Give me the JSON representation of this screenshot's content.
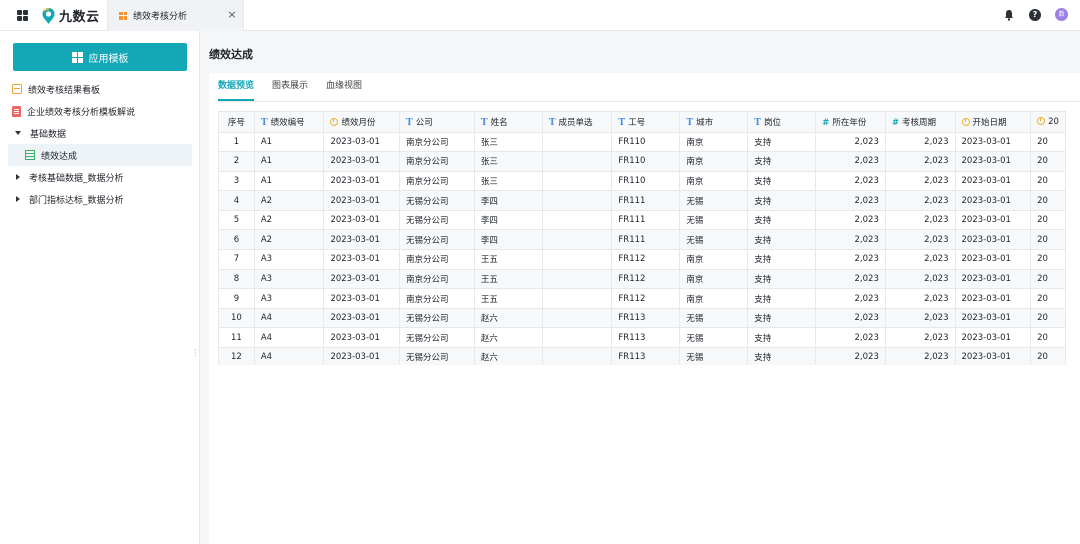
{
  "topbar": {
    "logo_text": "九数云",
    "tab_title": "绩效考核分析",
    "tab_close": "×",
    "help_glyph": "?",
    "avatar_text": "数"
  },
  "sidebar": {
    "apply_button": "应用模板",
    "items": [
      {
        "label": "绩效考核结果看板",
        "icon": "dashboard-icon"
      },
      {
        "label": "企业绩效考核分析模板解说",
        "icon": "document-icon"
      },
      {
        "label": "基础数据",
        "icon": "caret-down-icon"
      },
      {
        "label": "绩效达成",
        "icon": "table-icon",
        "selected": true
      },
      {
        "label": "考核基础数据_数据分析",
        "icon": "caret-right-icon"
      },
      {
        "label": "部门指标达标_数据分析",
        "icon": "caret-right-icon"
      }
    ]
  },
  "main": {
    "title": "绩效达成",
    "subtabs": [
      "数据预览",
      "图表展示",
      "血缘视图"
    ],
    "active_subtab": "数据预览"
  },
  "table": {
    "headers": [
      "序号",
      "绩效编号",
      "绩效月份",
      "公司",
      "姓名",
      "成员单选",
      "工号",
      "城市",
      "岗位",
      "所在年份",
      "考核周期",
      "开始日期",
      "20"
    ],
    "header_types": [
      "none",
      "text",
      "date",
      "text",
      "text",
      "text",
      "text",
      "text",
      "text",
      "number",
      "number",
      "date",
      "date"
    ],
    "rows": [
      [
        "1",
        "A1",
        "2023-03-01",
        "南京分公司",
        "张三",
        "",
        "FR110",
        "南京",
        "支持",
        "2,023",
        "2,023",
        "2023-03-01",
        "20"
      ],
      [
        "2",
        "A1",
        "2023-03-01",
        "南京分公司",
        "张三",
        "",
        "FR110",
        "南京",
        "支持",
        "2,023",
        "2,023",
        "2023-03-01",
        "20"
      ],
      [
        "3",
        "A1",
        "2023-03-01",
        "南京分公司",
        "张三",
        "",
        "FR110",
        "南京",
        "支持",
        "2,023",
        "2,023",
        "2023-03-01",
        "20"
      ],
      [
        "4",
        "A2",
        "2023-03-01",
        "无锡分公司",
        "李四",
        "",
        "FR111",
        "无锡",
        "支持",
        "2,023",
        "2,023",
        "2023-03-01",
        "20"
      ],
      [
        "5",
        "A2",
        "2023-03-01",
        "无锡分公司",
        "李四",
        "",
        "FR111",
        "无锡",
        "支持",
        "2,023",
        "2,023",
        "2023-03-01",
        "20"
      ],
      [
        "6",
        "A2",
        "2023-03-01",
        "无锡分公司",
        "李四",
        "",
        "FR111",
        "无锡",
        "支持",
        "2,023",
        "2,023",
        "2023-03-01",
        "20"
      ],
      [
        "7",
        "A3",
        "2023-03-01",
        "南京分公司",
        "王五",
        "",
        "FR112",
        "南京",
        "支持",
        "2,023",
        "2,023",
        "2023-03-01",
        "20"
      ],
      [
        "8",
        "A3",
        "2023-03-01",
        "南京分公司",
        "王五",
        "",
        "FR112",
        "南京",
        "支持",
        "2,023",
        "2,023",
        "2023-03-01",
        "20"
      ],
      [
        "9",
        "A3",
        "2023-03-01",
        "南京分公司",
        "王五",
        "",
        "FR112",
        "南京",
        "支持",
        "2,023",
        "2,023",
        "2023-03-01",
        "20"
      ],
      [
        "10",
        "A4",
        "2023-03-01",
        "无锡分公司",
        "赵六",
        "",
        "FR113",
        "无锡",
        "支持",
        "2,023",
        "2,023",
        "2023-03-01",
        "20"
      ],
      [
        "11",
        "A4",
        "2023-03-01",
        "无锡分公司",
        "赵六",
        "",
        "FR113",
        "无锡",
        "支持",
        "2,023",
        "2,023",
        "2023-03-01",
        "20"
      ],
      [
        "12",
        "A4",
        "2023-03-01",
        "无锡分公司",
        "赵六",
        "",
        "FR113",
        "无锡",
        "支持",
        "2,023",
        "2,023",
        "2023-03-01",
        "20"
      ]
    ]
  },
  "colors": {
    "accent": "#14a8b7",
    "text_type_icon": "#4a90e2",
    "date_type_icon": "#f0b12b",
    "number_type_icon": "#14a8b7"
  }
}
